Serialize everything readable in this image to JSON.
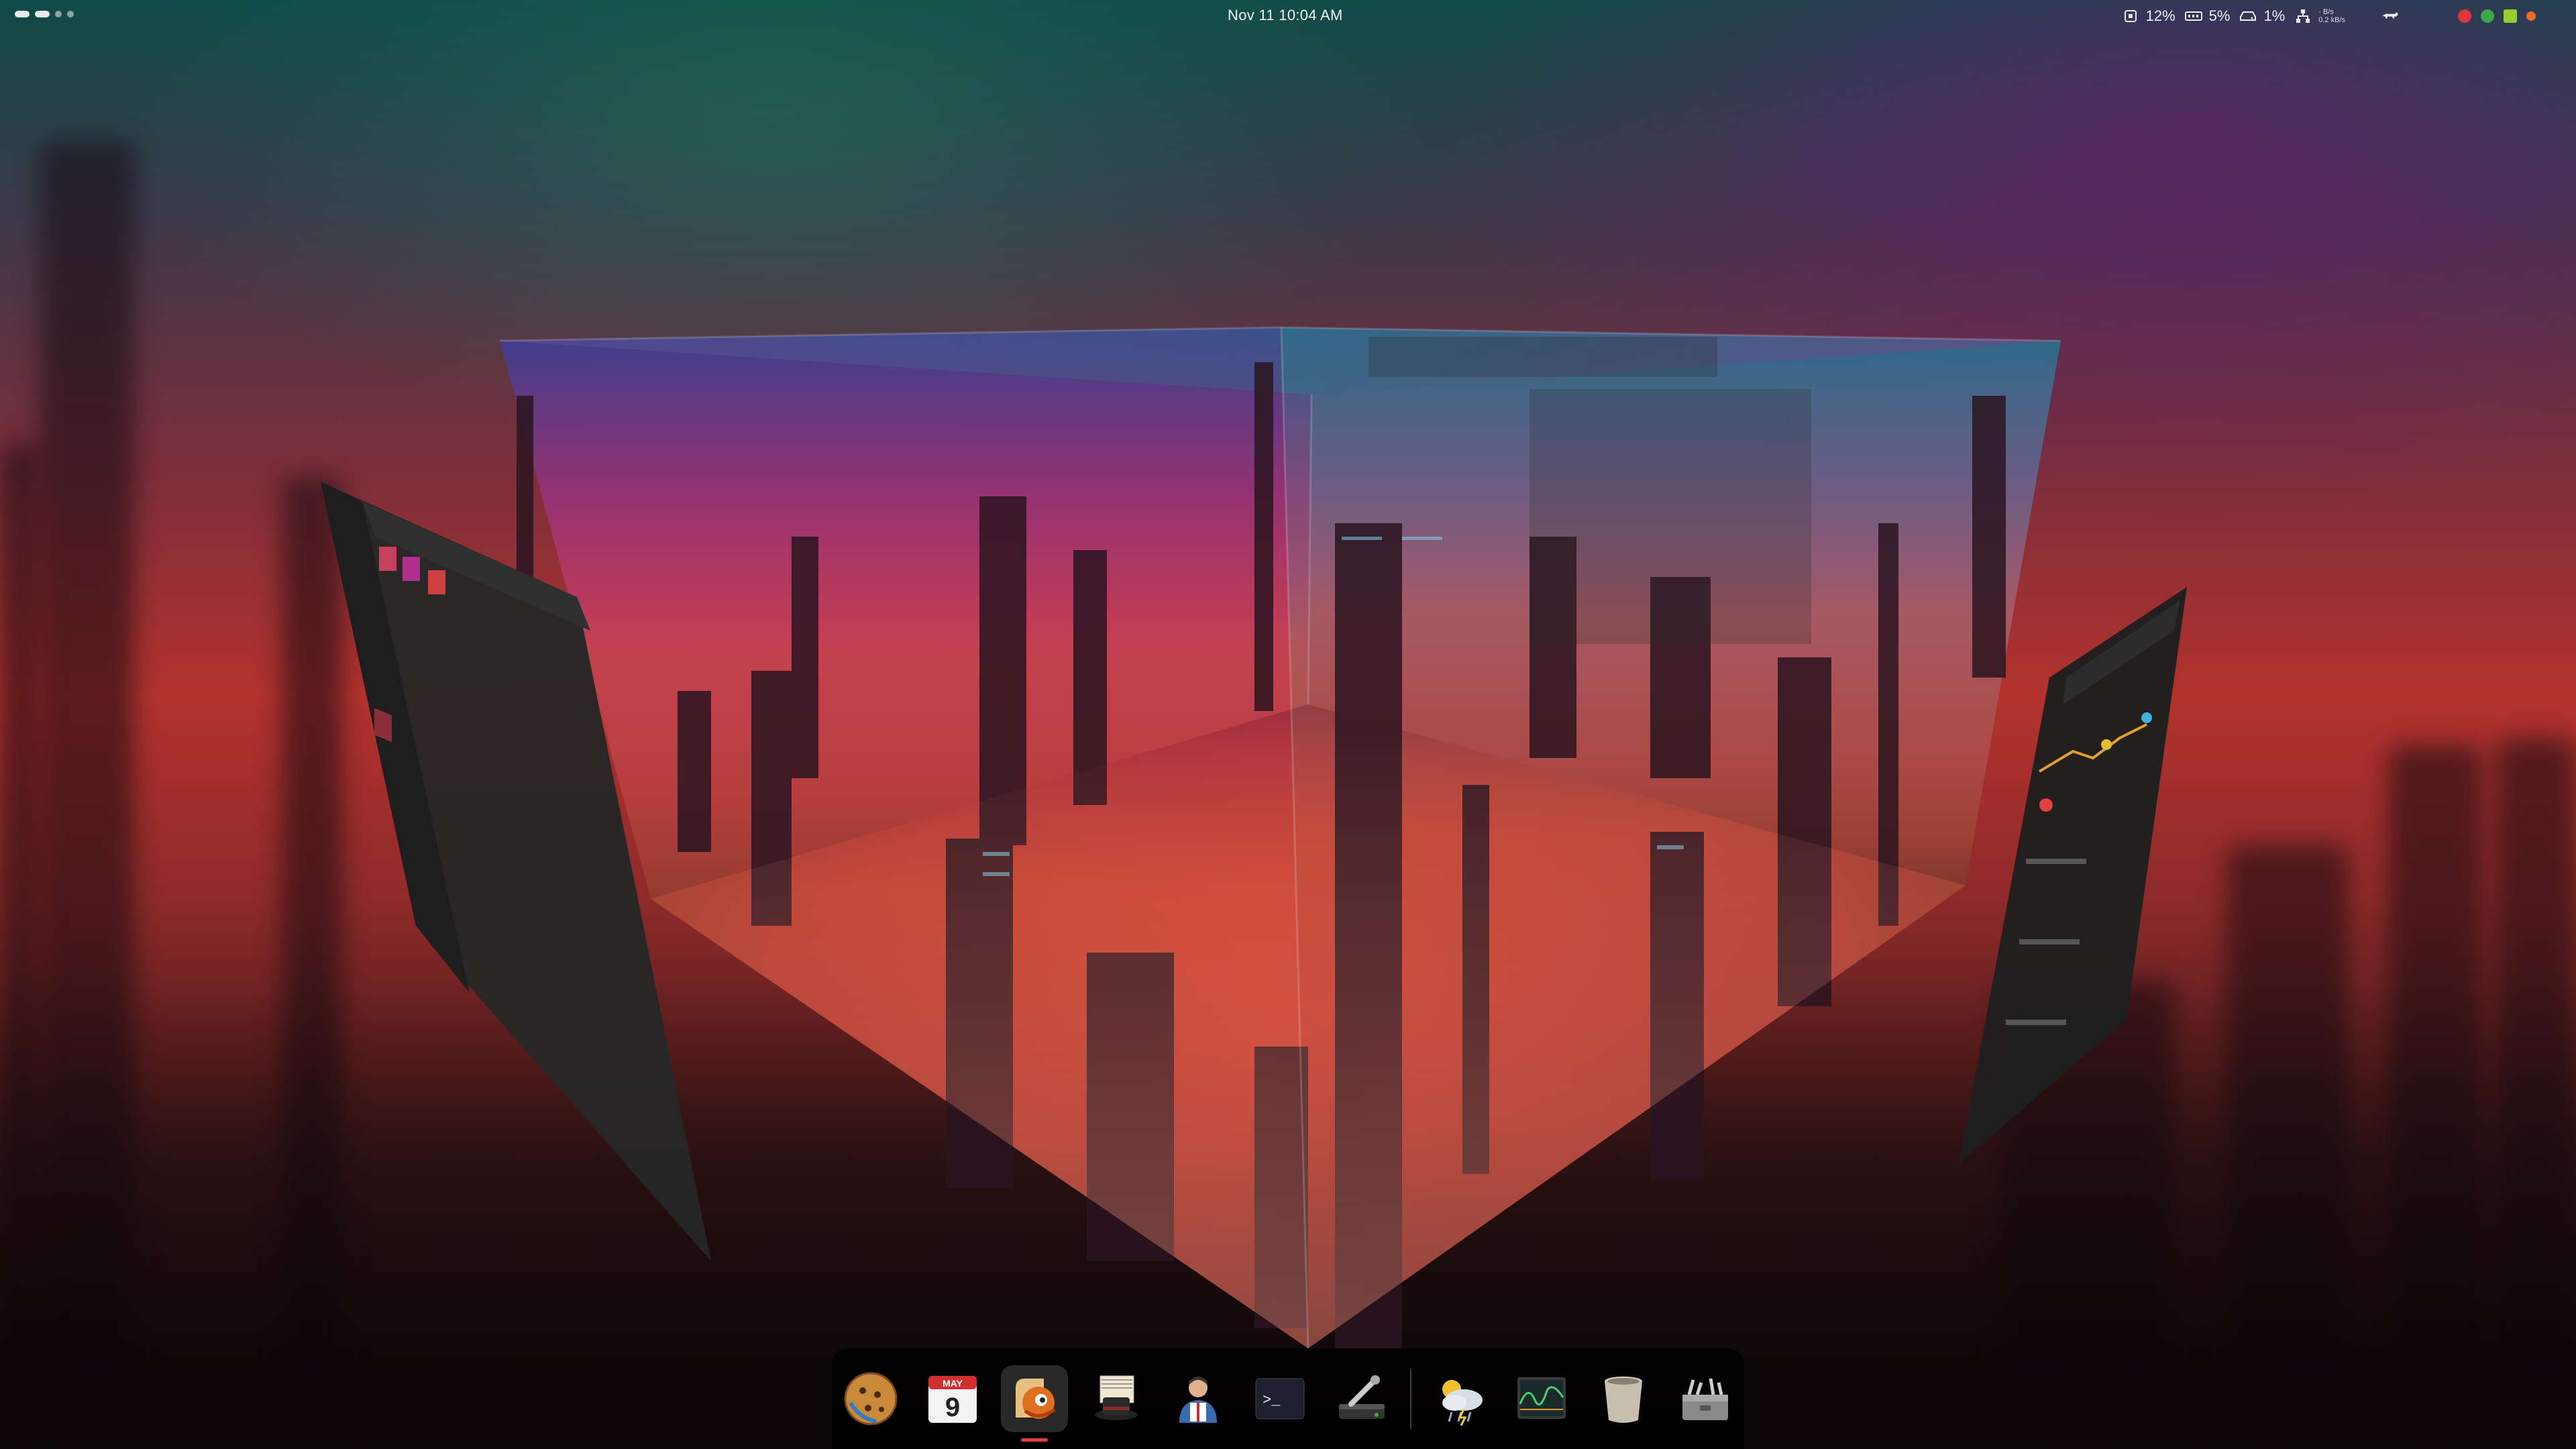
{
  "top_panel": {
    "clock": "Nov 11  10:04 AM",
    "cpu_percent": "12%",
    "memory_percent": "5%",
    "disk_percent": "1%",
    "net_up": "· B/s",
    "net_down": "0.2 kB/s",
    "icons": {
      "cpu": "cpu-icon",
      "memory": "memory-icon",
      "disk": "disk-icon",
      "network": "network-icon",
      "extension": "cat-icon"
    },
    "tray_colors": [
      "#e0353a",
      "#3aa84a",
      "#9acd32",
      "#f06a2a"
    ]
  },
  "workspaces": {
    "count": 4,
    "active_index": 0
  },
  "dock": {
    "items": [
      {
        "name": "cookie-app-icon",
        "label": ""
      },
      {
        "name": "calendar-icon",
        "month": "MAY",
        "day": "9"
      },
      {
        "name": "rhythmbox-icon",
        "label": "",
        "active": true
      },
      {
        "name": "notes-hat-icon",
        "label": ""
      },
      {
        "name": "contacts-icon",
        "label": ""
      },
      {
        "name": "terminal-icon",
        "prompt": ">_"
      },
      {
        "name": "disk-utility-icon",
        "label": ""
      },
      {
        "name": "weather-icon",
        "label": ""
      },
      {
        "name": "system-monitor-icon",
        "label": ""
      },
      {
        "name": "trash-icon",
        "label": ""
      },
      {
        "name": "toolbox-icon",
        "label": ""
      }
    ]
  },
  "colors": {
    "panel_text": "#eeeeee",
    "dock_bg": "#000000",
    "window_bg": "#262626",
    "accent_red": "#e04040"
  }
}
